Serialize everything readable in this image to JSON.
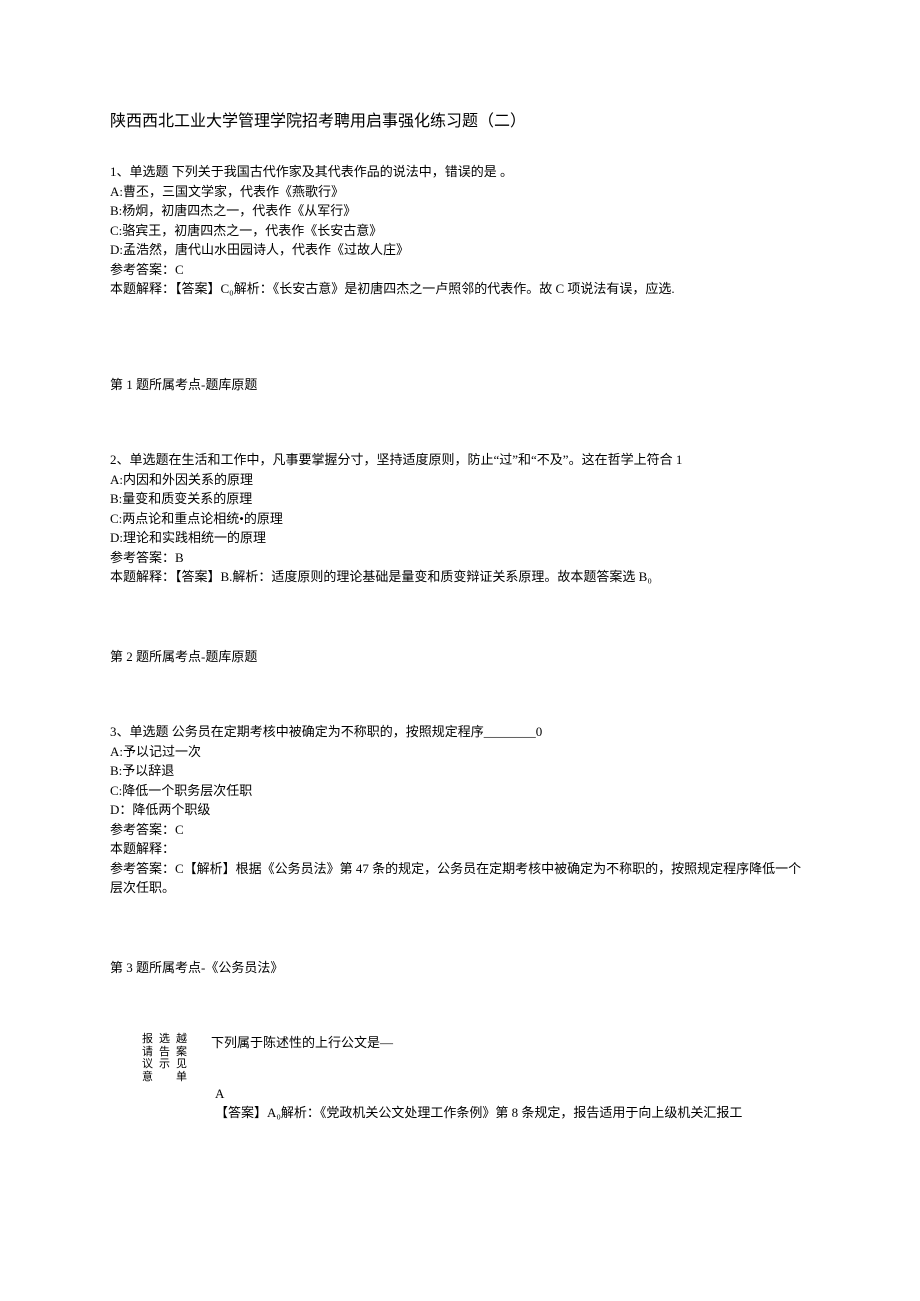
{
  "title": "陕西西北工业大学管理学院招考聘用启事强化练习题（二）",
  "q1": {
    "stem": "1、单选题      下列关于我国古代作家及其代表作品的说法中，错误的是          。",
    "optA": "A:曹丕，三国文学家，代表作《燕歌行》",
    "optB": "B:杨炯，初唐四杰之一，代表作《从军行》",
    "optC": "C:骆宾王，初唐四杰之一，代表作《长安古意》",
    "optD": "D:孟浩然，唐代山水田园诗人，代表作《过故人庄》",
    "ans": "参考答案：C",
    "exp": "本题解释：【答案】C₀解析：《长安古意》是初唐四杰之一卢照邻的代表作。故 C 项说法有误，应选.",
    "point": "第 1 题所属考点-题库原题"
  },
  "q2": {
    "stem": "2、单选题在生活和工作中，凡事要掌握分寸，坚持适度原则，防止“过”和“不及”。这在哲学上符合 1",
    "optA": "A:内因和外因关系的原理",
    "optB": "B:量变和质变关系的原理",
    "optC": "C:两点论和重点论相统•的原理",
    "optD": "D:理论和实践相统一的原理",
    "ans": "参考答案：B",
    "exp": "本题解释：【答案】B.解析：适度原则的理论基础是量变和质变辩证关系原理。故本题答案选 B₀",
    "point": "第 2 题所属考点-题库原题"
  },
  "q3": {
    "stem": "3、单选题       公务员在定期考核中被确定为不称职的，按照规定程序________0",
    "optA": "A:予以记过一次",
    "optB": "B:予以辞退",
    "optC": "C:降低一个职务层次任职",
    "optD": "D：降低两个职级",
    "ans": "参考答案：C",
    "exp1": "本题解释：",
    "exp2": "参考答案：C【解析】根据《公务员法》第 47 条的规定，公务员在定期考核中被确定为不称职的，按照规定程序降低一个层次任职。",
    "point": "第 3 题所属考点-《公务员法》"
  },
  "q4": {
    "col1": [
      "报",
      "请",
      "议",
      "意"
    ],
    "col2": [
      "选",
      "告",
      "示"
    ],
    "col3": [
      "越",
      "",
      "案",
      "见",
      "单"
    ],
    "stem": "下列属于陈述性的上行公文是—",
    "ansLetter": "A",
    "exp": "【答案】A₀解析：《党政机关公文处理工作条例》第 8 条规定，报告适用于向上级机关汇报工"
  }
}
